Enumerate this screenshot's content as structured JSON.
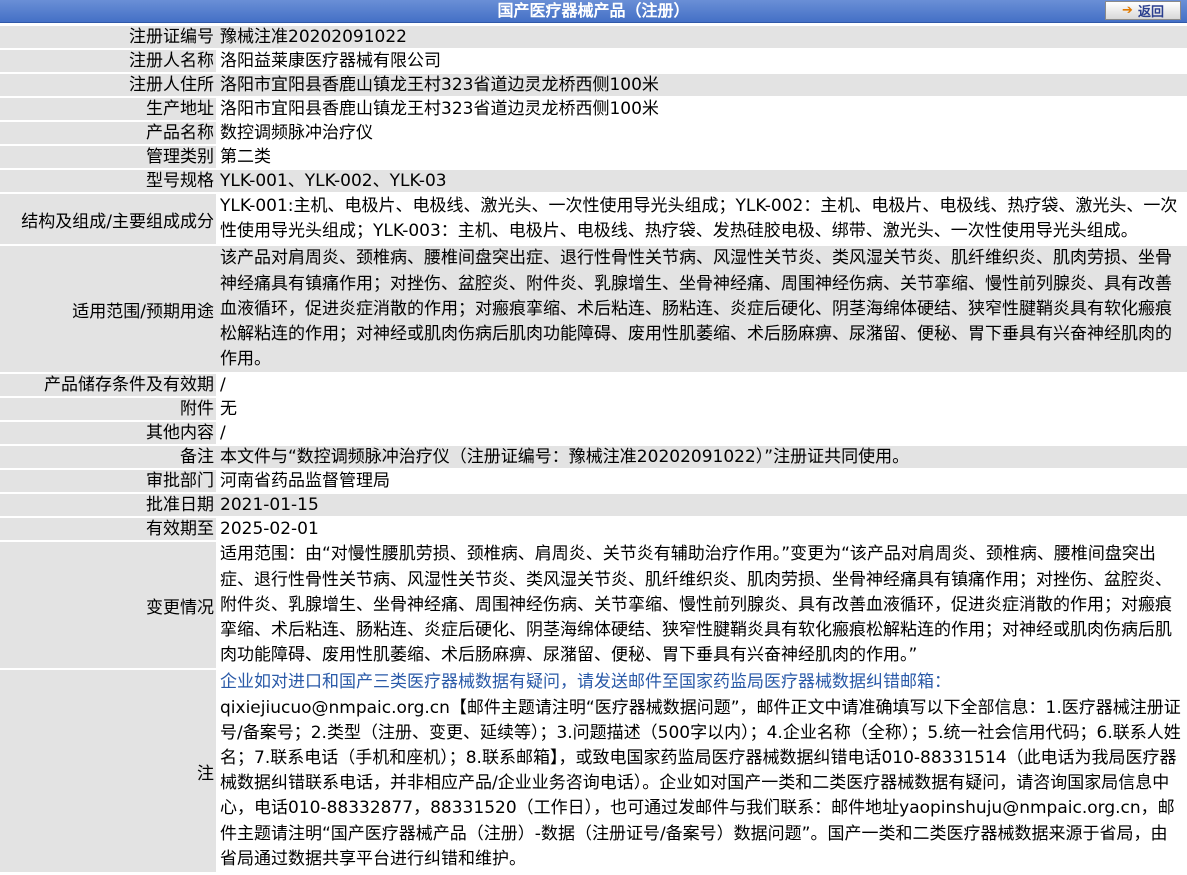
{
  "header": {
    "title": "国产医疗器械产品（注册）",
    "back_label": "返回",
    "back_icon": "arrow-right-icon"
  },
  "rows": {
    "reg_no": {
      "label": "注册证编号",
      "value": "豫械注准20202091022"
    },
    "registrant_name": {
      "label": "注册人名称",
      "value": "洛阳益莱康医疗器械有限公司"
    },
    "registrant_address": {
      "label": "注册人住所",
      "value": "洛阳市宜阳县香鹿山镇龙王村323省道边灵龙桥西侧100米"
    },
    "production_address": {
      "label": "生产地址",
      "value": "洛阳市宜阳县香鹿山镇龙王村323省道边灵龙桥西侧100米"
    },
    "product_name": {
      "label": "产品名称",
      "value": "数控调频脉冲治疗仪"
    },
    "management_class": {
      "label": "管理类别",
      "value": "第二类"
    },
    "model_spec": {
      "label": "型号规格",
      "value": "YLK-001、YLK-002、YLK-03"
    },
    "structure": {
      "label": "结构及组成/主要组成成分",
      "value": "YLK-001:主机、电极片、电极线、激光头、一次性使用导光头组成；YLK-002：主机、电极片、电极线、热疗袋、激光头、一次性使用导光头组成；YLK-003：主机、电极片、电极线、热疗袋、发热硅胶电极、绑带、激光头、一次性使用导光头组成。"
    },
    "intended_use": {
      "label": "适用范围/预期用途",
      "value": "该产品对肩周炎、颈椎病、腰椎间盘突出症、退行性骨性关节病、风湿性关节炎、类风湿关节炎、肌纤维织炎、肌肉劳损、坐骨神经痛具有镇痛作用；对挫伤、盆腔炎、附件炎、乳腺增生、坐骨神经痛、周围神经伤病、关节挛缩、慢性前列腺炎、具有改善血液循环，促进炎症消散的作用；对瘢痕挛缩、术后粘连、肠粘连、炎症后硬化、阴茎海绵体硬结、狭窄性腱鞘炎具有软化瘢痕松解粘连的作用；对神经或肌肉伤病后肌肉功能障碍、废用性肌萎缩、术后肠麻痹、尿潴留、便秘、胃下垂具有兴奋神经肌肉的作用。"
    },
    "storage": {
      "label": "产品储存条件及有效期",
      "value": "/"
    },
    "attachment": {
      "label": "附件",
      "value": "无"
    },
    "other": {
      "label": "其他内容",
      "value": "/"
    },
    "remark": {
      "label": "备注",
      "value": "本文件与“数控调频脉冲治疗仪（注册证编号：豫械注准20202091022）”注册证共同使用。"
    },
    "approval_dept": {
      "label": "审批部门",
      "value": "河南省药品监督管理局"
    },
    "approval_date": {
      "label": "批准日期",
      "value": "2021-01-15"
    },
    "valid_until": {
      "label": "有效期至",
      "value": "2025-02-01"
    },
    "changes": {
      "label": "变更情况",
      "value": "适用范围：由“对慢性腰肌劳损、颈椎病、肩周炎、关节炎有辅助治疗作用。”变更为“该产品对肩周炎、颈椎病、腰椎间盘突出症、退行性骨性关节病、风湿性关节炎、类风湿关节炎、肌纤维织炎、肌肉劳损、坐骨神经痛具有镇痛作用；对挫伤、盆腔炎、附件炎、乳腺增生、坐骨神经痛、周围神经伤病、关节挛缩、慢性前列腺炎、具有改善血液循环，促进炎症消散的作用；对瘢痕挛缩、术后粘连、肠粘连、炎症后硬化、阴茎海绵体硬结、狭窄性腱鞘炎具有软化瘢痕松解粘连的作用；对神经或肌肉伤病后肌肉功能障碍、废用性肌萎缩、术后肠麻痹、尿潴留、便秘、胃下垂具有兴奋神经肌肉的作用。”"
    },
    "note": {
      "label": "注",
      "value_blue": "企业如对进口和国产三类医疗器械数据有疑问，请发送邮件至国家药监局医疗器械数据纠错邮箱：",
      "value_rest": "qixiejiucuo@nmpaic.org.cn【邮件主题请注明“医疗器械数据问题”，邮件正文中请准确填写以下全部信息：1.医疗器械注册证号/备案号；2.类型（注册、变更、延续等）；3.问题描述（500字以内）；4.企业名称（全称）；5.统一社会信用代码；6.联系人姓名；7.联系电话（手机和座机）；8.联系邮箱】，或致电国家药监局医疗器械数据纠错电话010-88331514（此电话为我局医疗器械数据纠错联系电话，并非相应产品/企业业务咨询电话）。企业如对国产一类和二类医疗器械数据有疑问，请咨询国家局信息中心，电话010-88332877，88331520（工作日），也可通过发邮件与我们联系：邮件地址yaopinshuju@nmpaic.org.cn，邮件主题请注明“国产医疗器械产品（注册）-数据（注册证号/备案号）数据问题”。国产一类和二类医疗器械数据来源于省局，由省局通过数据共享平台进行纠错和维护。"
    }
  }
}
